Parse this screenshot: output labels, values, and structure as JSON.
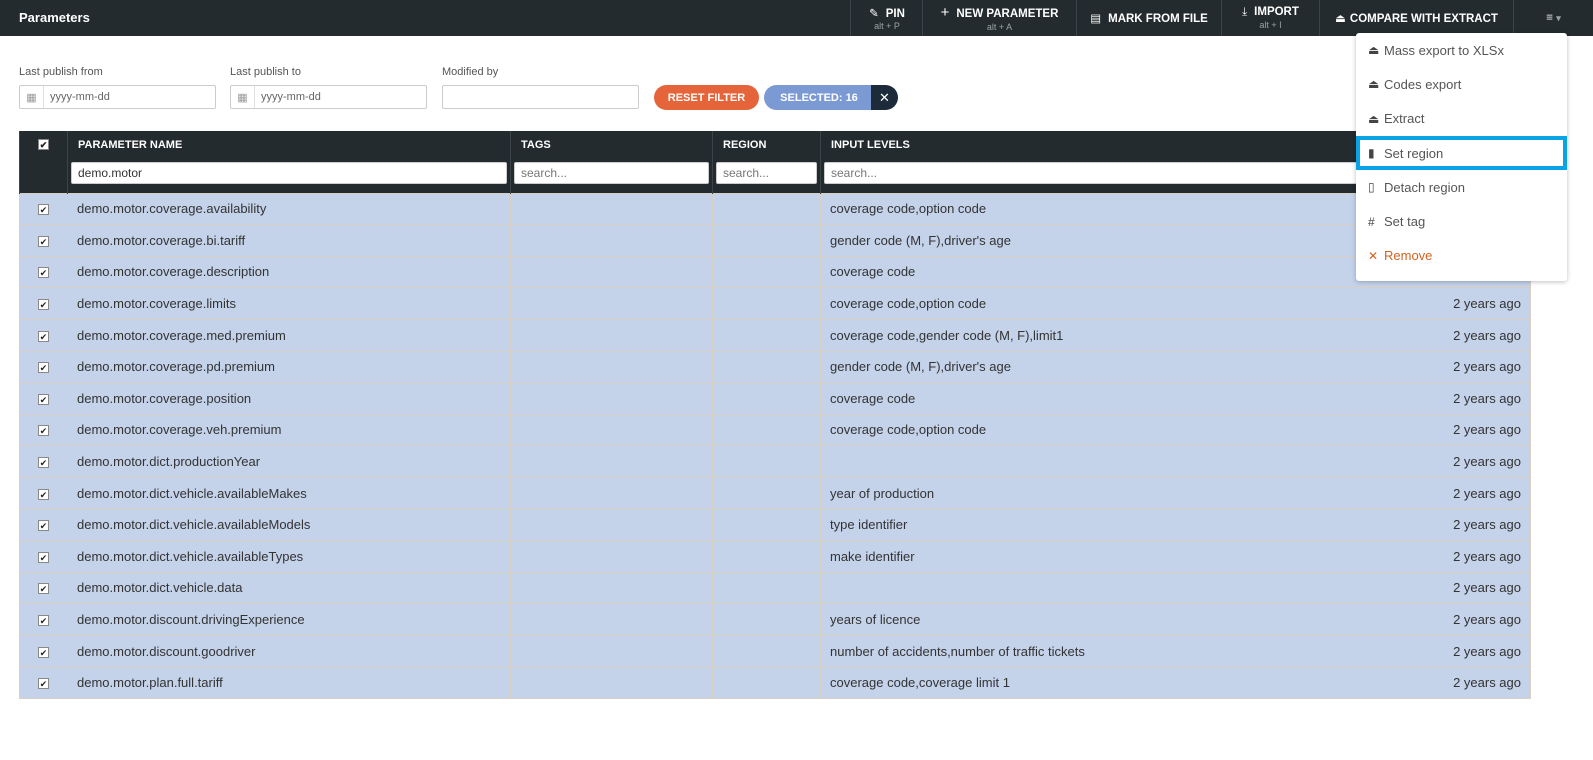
{
  "header": {
    "title": "Parameters",
    "buttons": [
      {
        "label": "PIN",
        "shortcut": "alt + P",
        "icon": "pin-icon"
      },
      {
        "label": "NEW PARAMETER",
        "shortcut": "alt + A",
        "icon": "plus-icon"
      },
      {
        "label": "MARK FROM FILE",
        "icon": "table-icon"
      },
      {
        "label": "IMPORT",
        "shortcut": "alt + I",
        "icon": "download-icon"
      },
      {
        "label": "COMPARE WITH EXTRACT",
        "icon": "upload-tray-icon"
      }
    ]
  },
  "filters": {
    "from_label": "Last publish from",
    "from_placeholder": "yyyy-mm-dd",
    "to_label": "Last publish to",
    "to_placeholder": "yyyy-mm-dd",
    "modified_label": "Modified by",
    "modified_value": "",
    "reset": "RESET FILTER",
    "selected": "SELECTED: 16"
  },
  "table": {
    "headers": [
      "PARAMETER NAME",
      "TAGS",
      "REGION",
      "INPUT LEVELS"
    ],
    "filters": {
      "name": "demo.motor",
      "search_placeholder": "search..."
    },
    "rows": [
      {
        "name": "demo.motor.coverage.availability",
        "levels": "coverage code,option code",
        "date": ""
      },
      {
        "name": "demo.motor.coverage.bi.tariff",
        "levels": "gender code (M, F),driver's age",
        "date": ""
      },
      {
        "name": "demo.motor.coverage.description",
        "levels": "coverage code",
        "date": ""
      },
      {
        "name": "demo.motor.coverage.limits",
        "levels": "coverage code,option code",
        "date": "2 years ago"
      },
      {
        "name": "demo.motor.coverage.med.premium",
        "levels": "coverage code,gender code (M, F),limit1",
        "date": "2 years ago"
      },
      {
        "name": "demo.motor.coverage.pd.premium",
        "levels": "gender code (M, F),driver's age",
        "date": "2 years ago"
      },
      {
        "name": "demo.motor.coverage.position",
        "levels": "coverage code",
        "date": "2 years ago"
      },
      {
        "name": "demo.motor.coverage.veh.premium",
        "levels": "coverage code,option code",
        "date": "2 years ago"
      },
      {
        "name": "demo.motor.dict.productionYear",
        "levels": "",
        "date": "2 years ago"
      },
      {
        "name": "demo.motor.dict.vehicle.availableMakes",
        "levels": "year of production",
        "date": "2 years ago"
      },
      {
        "name": "demo.motor.dict.vehicle.availableModels",
        "levels": "type identifier",
        "date": "2 years ago"
      },
      {
        "name": "demo.motor.dict.vehicle.availableTypes",
        "levels": "make identifier",
        "date": "2 years ago"
      },
      {
        "name": "demo.motor.dict.vehicle.data",
        "levels": "",
        "date": "2 years ago"
      },
      {
        "name": "demo.motor.discount.drivingExperience",
        "levels": "years of licence",
        "date": "2 years ago"
      },
      {
        "name": "demo.motor.discount.goodriver",
        "levels": "number of accidents,number of traffic tickets",
        "date": "2 years ago"
      },
      {
        "name": "demo.motor.plan.full.tariff",
        "levels": "coverage code,coverage limit 1",
        "date": "2 years ago"
      }
    ]
  },
  "menu": {
    "items": [
      {
        "label": "Mass export to XLSx",
        "icon": "export-icon"
      },
      {
        "label": "Codes export",
        "icon": "export-icon"
      },
      {
        "label": "Extract",
        "icon": "export-icon"
      },
      {
        "label": "Set region",
        "icon": "bookmark-filled-icon"
      },
      {
        "label": "Detach region",
        "icon": "bookmark-outline-icon"
      },
      {
        "label": "Set tag",
        "icon": "hash-icon"
      },
      {
        "label": "Remove",
        "icon": "close-icon"
      }
    ]
  },
  "colors": {
    "accent": "#e5643a",
    "selected": "#7b9ad3",
    "row": "#c4d2ea",
    "highlight": "#0aa3e3",
    "dark": "#232b2e"
  }
}
